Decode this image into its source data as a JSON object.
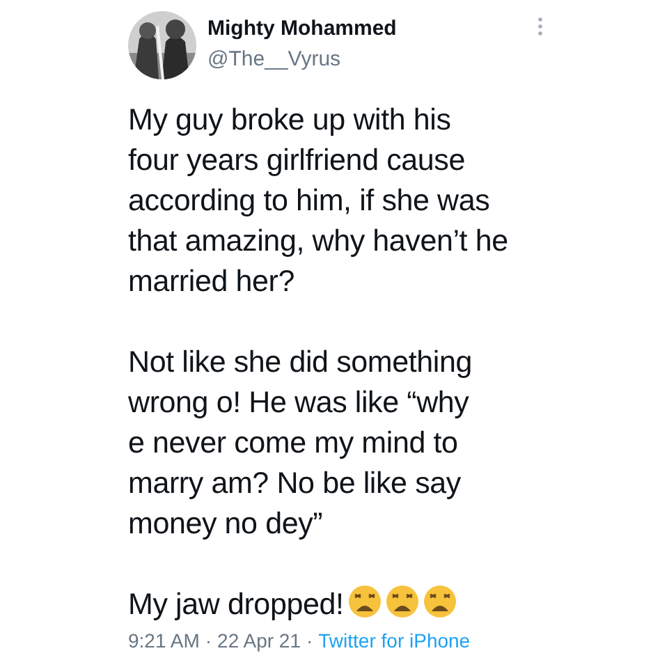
{
  "author": {
    "name": "Mighty Mohammed",
    "handle": "@The__Vyrus"
  },
  "paragraphs": [
    "My guy broke up with his\nfour years girlfriend cause\naccording to him, if she was\nthat amazing, why haven’t he\nmarried her?",
    "Not like she did something\nwrong o! He was like “why\ne never come my mind to\nmarry am? No be like say\nmoney no dey”",
    "My jaw dropped!"
  ],
  "footer": {
    "time": "9:21 AM",
    "separator_1": "·",
    "date": "22 Apr 21",
    "separator_2": "·",
    "source": "Twitter for iPhone"
  }
}
